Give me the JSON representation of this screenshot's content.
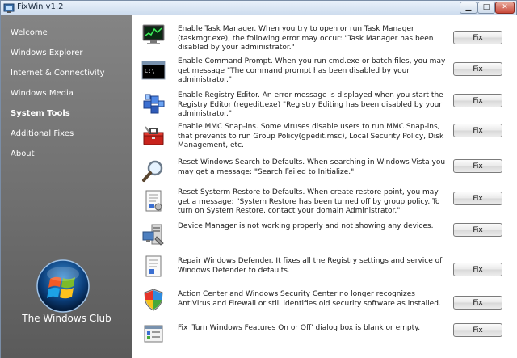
{
  "window": {
    "title": "FixWin v1.2"
  },
  "sidebar": {
    "items": [
      {
        "label": "Welcome"
      },
      {
        "label": "Windows Explorer"
      },
      {
        "label": "Internet & Connectivity"
      },
      {
        "label": "Windows Media"
      },
      {
        "label": "System Tools",
        "active": true
      },
      {
        "label": "Additional Fixes"
      },
      {
        "label": "About"
      }
    ],
    "brand": "The Windows Club"
  },
  "fixes": [
    {
      "icon": "task-manager-icon",
      "text": "Enable Task Manager. When you try to open or run Task Manager (taskmgr.exe), the following error may occur: \"Task Manager has been disabled by your administrator.\"",
      "button": "Fix"
    },
    {
      "icon": "command-prompt-icon",
      "text": "Enable Command Prompt. When you run cmd.exe or batch files, you may get message \"The command prompt has been disabled by your administrator.\"",
      "button": "Fix"
    },
    {
      "icon": "registry-editor-icon",
      "text": "Enable Registry Editor. An error message is displayed when you start the Registry Editor (regedit.exe) \"Registry Editing has been disabled by your administrator.\"",
      "button": "Fix"
    },
    {
      "icon": "mmc-toolbox-icon",
      "text": "Enable MMC Snap-ins. Some viruses disable users to run MMC Snap-ins, that prevents to run Group Policy(gpedit.msc), Local Security Policy, Disk Management, etc.",
      "button": "Fix"
    },
    {
      "icon": "magnifier-icon",
      "text": "Reset Windows Search to Defaults. When searching in Windows Vista you may get a message: \"Search Failed to Initialize.\"",
      "button": "Fix"
    },
    {
      "icon": "system-restore-icon",
      "text": "Reset Systerm Restore to Defaults. When create restore point, you may get a message: \"System Restore has been turned off by group policy. To turn on System Restore, contact your domain Administrator.\"",
      "button": "Fix"
    },
    {
      "icon": "device-manager-icon",
      "text": "Device Manager is not working properly and not showing any devices.",
      "button": "Fix"
    },
    {
      "icon": "windows-defender-icon",
      "text": "Repair Windows Defender. It fixes all the Registry settings and service of Windows Defender to defaults.",
      "button": "Fix"
    },
    {
      "icon": "security-shield-icon",
      "text": "Action Center and Windows Security Center no longer recognizes AntiVirus and Firewall or still identifies old security software as installed.",
      "button": "Fix"
    },
    {
      "icon": "windows-features-icon",
      "text": "Fix 'Turn Windows Features On or Off' dialog box is blank or empty.",
      "button": "Fix"
    }
  ]
}
